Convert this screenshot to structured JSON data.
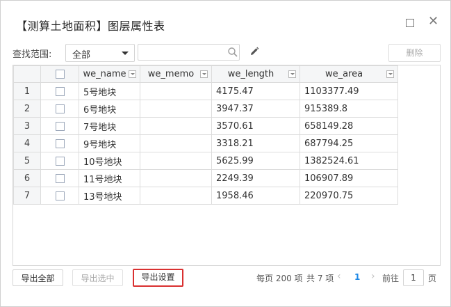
{
  "window": {
    "title": "【测算土地面积】图层属性表"
  },
  "toolbar": {
    "search_label": "查找范围:",
    "scope_value": "全部",
    "search_placeholder": "",
    "delete_label": "删除"
  },
  "table": {
    "columns": [
      "we_name",
      "we_memo",
      "we_length",
      "we_area"
    ],
    "rows": [
      {
        "num": "1",
        "we_name": "5号地块",
        "we_memo": "",
        "we_length": "4175.47",
        "we_area": "1103377.49"
      },
      {
        "num": "2",
        "we_name": "6号地块",
        "we_memo": "",
        "we_length": "3947.37",
        "we_area": "915389.8"
      },
      {
        "num": "3",
        "we_name": "7号地块",
        "we_memo": "",
        "we_length": "3570.61",
        "we_area": "658149.28"
      },
      {
        "num": "4",
        "we_name": "9号地块",
        "we_memo": "",
        "we_length": "3318.21",
        "we_area": "687794.25"
      },
      {
        "num": "5",
        "we_name": "10号地块",
        "we_memo": "",
        "we_length": "5625.99",
        "we_area": "1382524.61"
      },
      {
        "num": "6",
        "we_name": "11号地块",
        "we_memo": "",
        "we_length": "2249.39",
        "we_area": "106907.89"
      },
      {
        "num": "7",
        "we_name": "13号地块",
        "we_memo": "",
        "we_length": "1958.46",
        "we_area": "220970.75"
      }
    ]
  },
  "footer": {
    "export_all": "导出全部",
    "export_selected": "导出选中",
    "export_settings": "导出设置",
    "highlight_color": "#d93030"
  },
  "pager": {
    "page_size_text": "每页 200 项",
    "total_text": "共 7 项",
    "prev": "‹",
    "current_page": "1",
    "next": "›",
    "goto_label": "前往",
    "goto_value": "1",
    "page_suffix": "页",
    "accent_color": "#1e88e5"
  }
}
